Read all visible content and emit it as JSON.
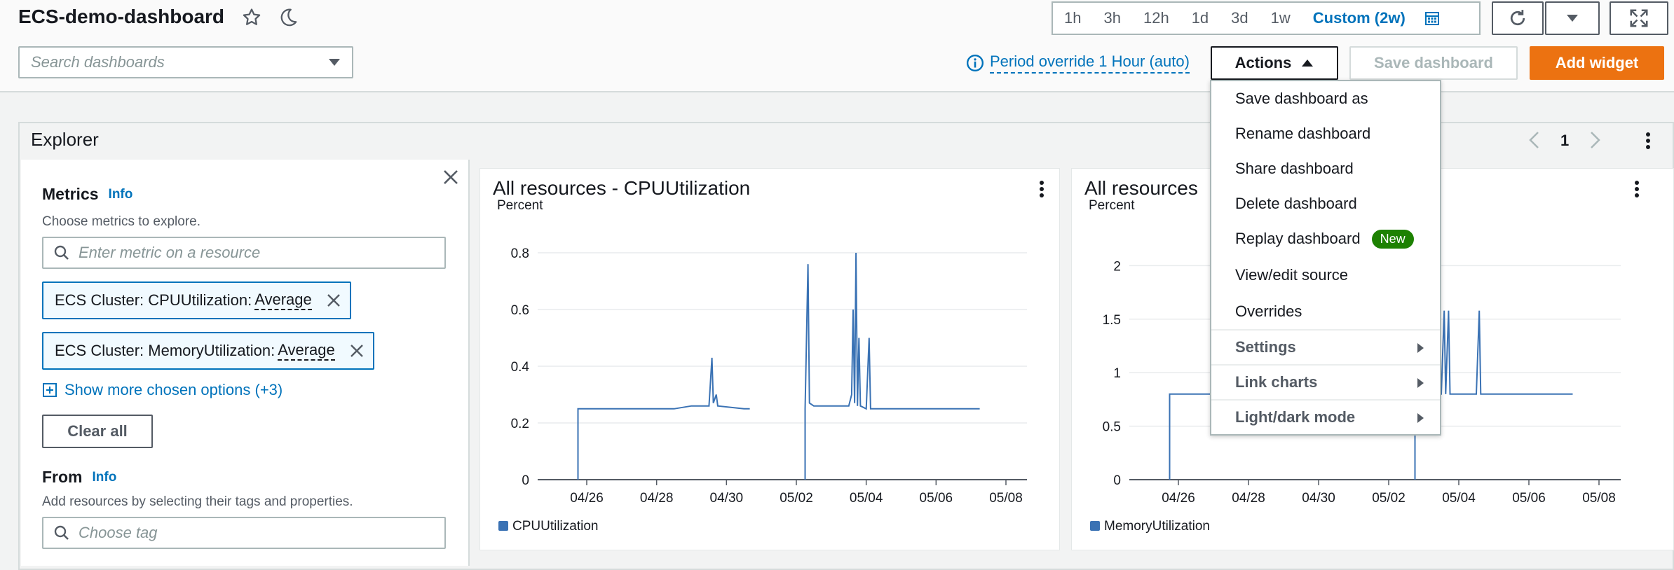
{
  "header": {
    "title": "ECS-demo-dashboard",
    "time_ranges": [
      "1h",
      "3h",
      "12h",
      "1d",
      "3d",
      "1w"
    ],
    "custom_range": "Custom (2w)",
    "search_placeholder": "Search dashboards",
    "period_override": "Period override 1 Hour (auto)",
    "actions_label": "Actions",
    "save_label": "Save dashboard",
    "add_widget_label": "Add widget"
  },
  "actions_menu": {
    "items": [
      "Save dashboard as",
      "Rename dashboard",
      "Share dashboard",
      "Delete dashboard",
      "Replay dashboard",
      "View/edit source",
      "Overrides"
    ],
    "new_badge": "New",
    "submenus": [
      "Settings",
      "Link charts",
      "Light/dark mode"
    ]
  },
  "explorer": {
    "title": "Explorer",
    "page": "1",
    "metrics": {
      "title": "Metrics",
      "info": "Info",
      "description": "Choose metrics to explore.",
      "input_placeholder": "Enter metric on a resource",
      "tokens": [
        {
          "label": "ECS Cluster: CPUUtilization:",
          "stat": "Average"
        },
        {
          "label": "ECS Cluster: MemoryUtilization:",
          "stat": "Average"
        }
      ],
      "show_more": "Show more chosen options (+3)",
      "clear_all": "Clear all"
    },
    "from": {
      "title": "From",
      "info": "Info",
      "description": "Add resources by selecting their tags and properties.",
      "input_placeholder": "Choose tag"
    }
  },
  "colors": {
    "accent": "#0073bb",
    "series": "#3a72b4",
    "primary_button": "#ec7211",
    "new_badge": "#1d8102"
  },
  "chart_data": [
    {
      "type": "line",
      "title": "All resources - CPUUtilization",
      "ylabel": "Percent",
      "ylim": [
        0,
        0.8
      ],
      "yticks": [
        "0",
        "0.2",
        "0.4",
        "0.6",
        "0.8"
      ],
      "xticks": [
        "04/26",
        "04/28",
        "04/30",
        "05/02",
        "05/04",
        "05/06",
        "05/08"
      ],
      "legend": "CPUUtilization",
      "series": [
        {
          "name": "CPUUtilization",
          "segments": [
            [
              [
                "04/25 18:00",
                0
              ],
              [
                "04/25 18:00",
                0.25
              ],
              [
                "04/26 12:00",
                0.25
              ],
              [
                "04/27 12:00",
                0.25
              ],
              [
                "04/28 12:00",
                0.25
              ],
              [
                "04/29 00:00",
                0.26
              ],
              [
                "04/29 12:00",
                0.26
              ],
              [
                "04/29 14:00",
                0.43
              ],
              [
                "04/29 15:00",
                0.27
              ],
              [
                "04/29 17:00",
                0.3
              ],
              [
                "04/29 18:00",
                0.26
              ],
              [
                "04/30 12:00",
                0.25
              ],
              [
                "04/30 16:00",
                0.25
              ]
            ],
            [
              [
                "05/02 06:00",
                0
              ],
              [
                "05/02 06:00",
                0.25
              ],
              [
                "05/02 08:00",
                0.76
              ],
              [
                "05/02 09:00",
                0.27
              ],
              [
                "05/02 12:00",
                0.26
              ],
              [
                "05/03 00:00",
                0.26
              ],
              [
                "05/03 12:00",
                0.26
              ],
              [
                "05/03 14:00",
                0.3
              ],
              [
                "05/03 15:00",
                0.6
              ],
              [
                "05/03 16:00",
                0.27
              ],
              [
                "05/03 17:00",
                0.8
              ],
              [
                "05/03 18:00",
                0.26
              ],
              [
                "05/03 19:00",
                0.5
              ],
              [
                "05/03 20:00",
                0.26
              ],
              [
                "05/04 00:00",
                0.25
              ],
              [
                "05/04 02:00",
                0.5
              ],
              [
                "05/04 03:00",
                0.25
              ],
              [
                "05/05 00:00",
                0.25
              ],
              [
                "05/06 00:00",
                0.25
              ],
              [
                "05/07 00:00",
                0.25
              ],
              [
                "05/07 06:00",
                0.25
              ]
            ]
          ]
        }
      ]
    },
    {
      "type": "line",
      "title": "All resources",
      "ylabel": "Percent",
      "ylim": [
        0,
        2.5
      ],
      "yticks": [
        "0",
        "0.5",
        "1",
        "1.5",
        "2"
      ],
      "xticks": [
        "04/26",
        "04/28",
        "04/30",
        "05/02",
        "05/04",
        "05/06",
        "05/08"
      ],
      "legend": "MemoryUtilization",
      "series": [
        {
          "name": "MemoryUtilization",
          "segments": [
            [
              [
                "04/25 18:00",
                0
              ],
              [
                "04/25 18:00",
                0.8
              ],
              [
                "04/30 16:00",
                0.8
              ]
            ],
            [
              [
                "05/02 18:00",
                0
              ],
              [
                "05/02 18:00",
                0.8
              ],
              [
                "05/03 12:00",
                0.8
              ],
              [
                "05/03 14:00",
                1.58
              ],
              [
                "05/03 15:00",
                0.8
              ],
              [
                "05/03 17:00",
                1.58
              ],
              [
                "05/03 18:00",
                0.8
              ],
              [
                "05/04 12:00",
                0.8
              ],
              [
                "05/04 14:00",
                1.58
              ],
              [
                "05/04 15:00",
                0.8
              ],
              [
                "05/07 06:00",
                0.8
              ]
            ]
          ]
        }
      ]
    }
  ]
}
